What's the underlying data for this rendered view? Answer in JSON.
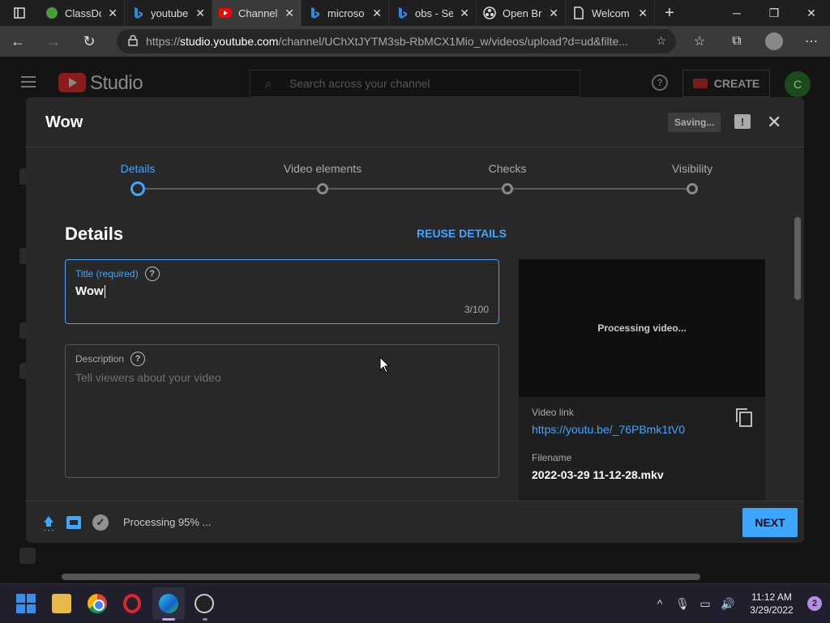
{
  "browser": {
    "tabs": [
      {
        "title": "ClassDo",
        "icon": "classdojo-icon",
        "active": false
      },
      {
        "title": "youtube",
        "icon": "bing-icon",
        "active": false
      },
      {
        "title": "Channel",
        "icon": "youtube-icon",
        "active": true
      },
      {
        "title": "microso",
        "icon": "bing-icon",
        "active": false
      },
      {
        "title": "obs - Se",
        "icon": "bing-icon",
        "active": false
      },
      {
        "title": "Open Br",
        "icon": "obs-icon",
        "active": false
      },
      {
        "title": "Welcom",
        "icon": "page-icon",
        "active": false
      }
    ],
    "url_host": "studio.youtube.com",
    "url_prefix": "https://",
    "url_rest": "/channel/UChXtJYTM3sb-RbMCX1Mio_w/videos/upload?d=ud&filte..."
  },
  "studio": {
    "logo_text": "Studio",
    "search_placeholder": "Search across your channel",
    "create_label": "CREATE",
    "avatar_letter": "C"
  },
  "dialog": {
    "title": "Wow",
    "saving_label": "Saving...",
    "steps": [
      {
        "label": "Details",
        "active": true
      },
      {
        "label": "Video elements",
        "active": false
      },
      {
        "label": "Checks",
        "active": false
      },
      {
        "label": "Visibility",
        "active": false
      }
    ],
    "section_title": "Details",
    "reuse_label": "REUSE DETAILS",
    "title_field": {
      "label": "Title (required)",
      "value": "Wow",
      "counter": "3/100"
    },
    "description_field": {
      "label": "Description",
      "placeholder": "Tell viewers about your video"
    },
    "preview": {
      "status": "Processing video...",
      "video_link_label": "Video link",
      "video_link": "https://youtu.be/_76PBmk1tV0",
      "filename_label": "Filename",
      "filename": "2022-03-29 11-12-28.mkv"
    },
    "footer": {
      "status": "Processing 95% ...",
      "next_label": "NEXT"
    }
  },
  "taskbar": {
    "time": "11:12 AM",
    "date": "3/29/2022",
    "notification_count": "2"
  }
}
